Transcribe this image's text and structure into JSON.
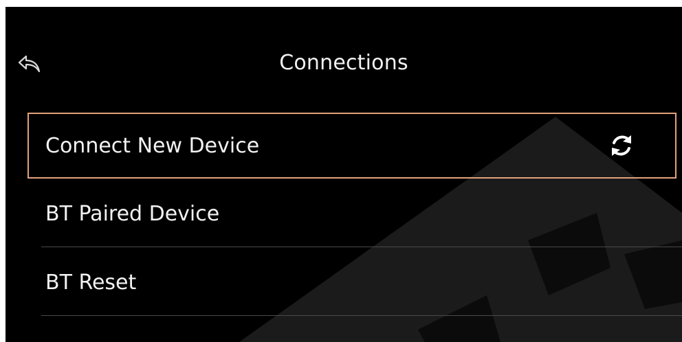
{
  "header": {
    "title": "Connections",
    "back_icon": "back-arrow-icon"
  },
  "menu": {
    "items": [
      {
        "label": "Connect New Device",
        "selected": true,
        "icon": "sync-icon"
      },
      {
        "label": "BT Paired Device",
        "selected": false
      },
      {
        "label": "BT Reset",
        "selected": false
      }
    ]
  },
  "colors": {
    "background": "#000000",
    "text": "#f2f2f2",
    "selection_border": "#e3a27a",
    "divider": "#4a4a4a"
  }
}
